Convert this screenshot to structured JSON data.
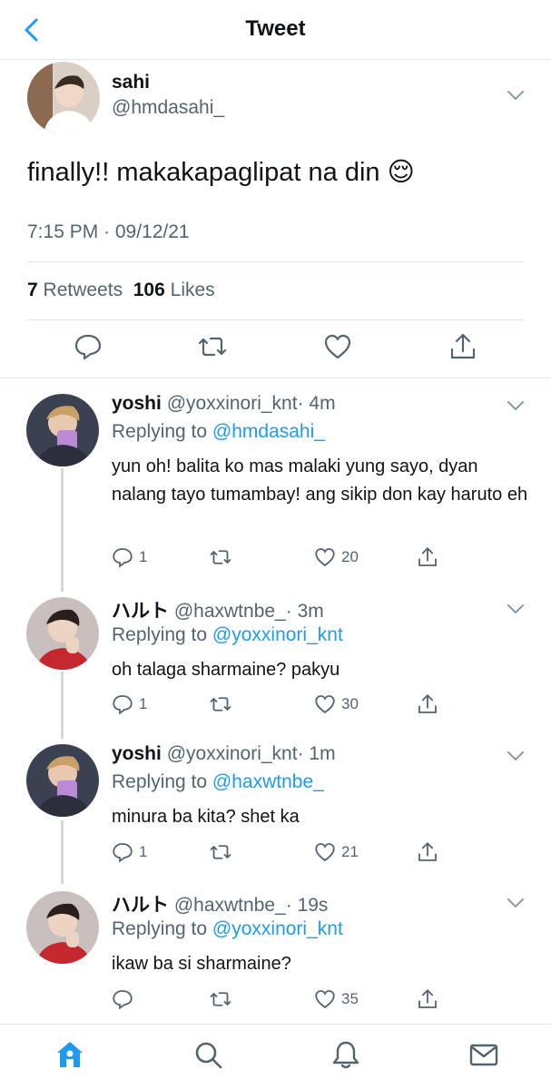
{
  "nav": {
    "title": "Tweet",
    "back_icon": "chevron-left-icon"
  },
  "tweet": {
    "author_name": "sahi",
    "author_handle": "@hmdasahi_",
    "text": "finally!! makakapaglipat na din 😌",
    "timestamp": "7:15 PM · 09/12/21",
    "retweets_count": "7",
    "retweets_label": "Retweets",
    "likes_count": "106",
    "likes_label": "Likes"
  },
  "replies": [
    {
      "name": "yoshi",
      "handle": "@yoxxinori_knt",
      "time": "· 4m",
      "replying_label": "Replying to",
      "replying_to": "@hmdasahi_",
      "text": "yun oh! balita ko mas malaki yung sayo, dyan nalang tayo tumambay! ang sikip don kay haruto eh",
      "reply_count": "1",
      "like_count": "20"
    },
    {
      "name": "ハルト",
      "handle": "@haxwtnbe_",
      "time": "· 3m",
      "replying_label": "Replying to",
      "replying_to": "@yoxxinori_knt",
      "text": "oh talaga sharmaine? pakyu",
      "reply_count": "1",
      "like_count": "30"
    },
    {
      "name": "yoshi",
      "handle": "@yoxxinori_knt",
      "time": "· 1m",
      "replying_label": "Replying to",
      "replying_to": "@haxwtnbe_",
      "text": "minura ba kita? shet ka",
      "reply_count": "1",
      "like_count": "21"
    },
    {
      "name": "ハルト",
      "handle": "@haxwtnbe_",
      "time": "· 19s",
      "replying_label": "Replying to",
      "replying_to": "@yoxxinori_knt",
      "text": "ikaw ba si sharmaine?",
      "reply_count": "",
      "like_count": "35"
    }
  ],
  "tabs": [
    "home-icon",
    "search-icon",
    "bell-icon",
    "mail-icon"
  ],
  "colors": {
    "accent": "#1d9bf0",
    "text": "#0f1419",
    "muted": "#536471",
    "divider": "#e1e8ed"
  }
}
